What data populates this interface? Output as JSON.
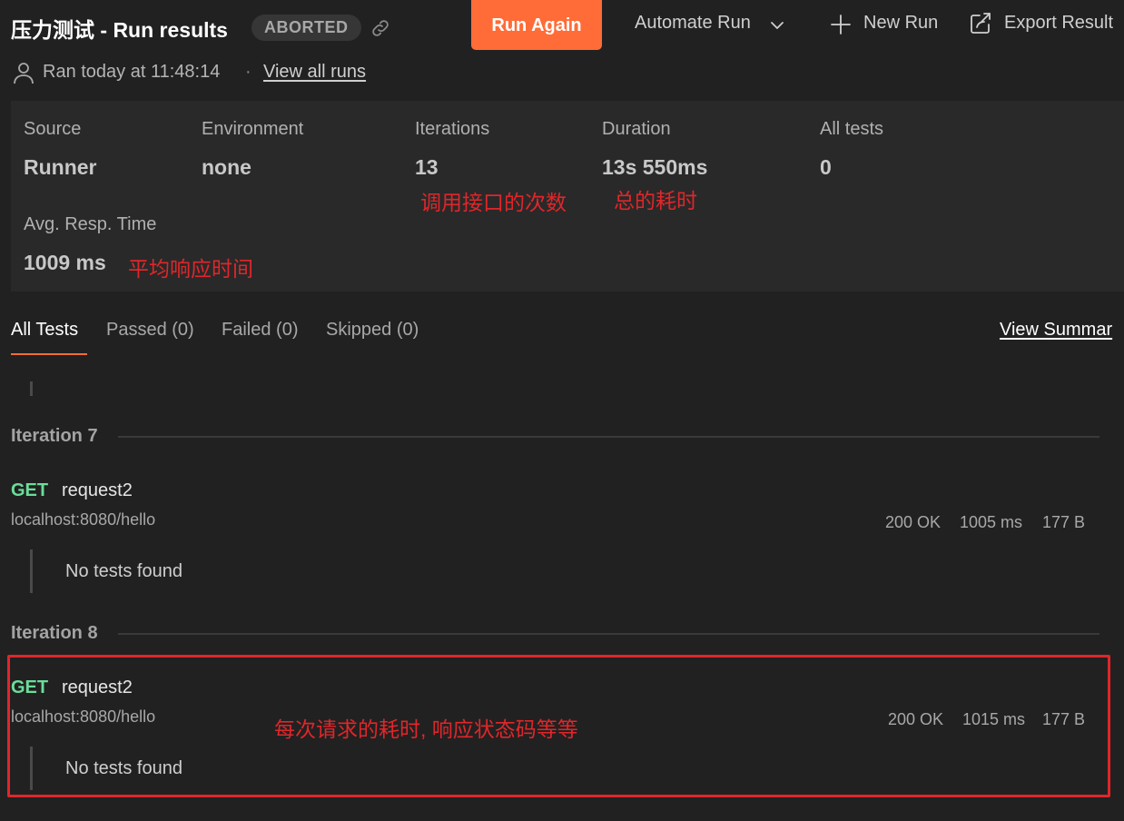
{
  "header": {
    "title": "压力测试 - Run results",
    "status_badge": "ABORTED",
    "run_again": "Run Again",
    "automate_run": "Automate Run",
    "new_run": "New Run",
    "export_results": "Export Result",
    "ran_text": "Ran today at 11:48:14",
    "separator": "·",
    "view_all_runs": "View all runs"
  },
  "summary": {
    "source": {
      "label": "Source",
      "value": "Runner"
    },
    "environment": {
      "label": "Environment",
      "value": "none"
    },
    "iterations": {
      "label": "Iterations",
      "value": "13"
    },
    "duration": {
      "label": "Duration",
      "value": "13s 550ms"
    },
    "all_tests": {
      "label": "All tests",
      "value": "0"
    },
    "avg_resp_time": {
      "label": "Avg. Resp. Time",
      "value": "1009 ms"
    }
  },
  "annotations": {
    "iterations": "调用接口的次数",
    "duration": "总的耗时",
    "avg_resp_time": "平均响应时间",
    "request": "每次请求的耗时, 响应状态码等等"
  },
  "tabs": [
    {
      "label": "All Tests",
      "active": true
    },
    {
      "label": "Passed (0)",
      "active": false
    },
    {
      "label": "Failed (0)",
      "active": false
    },
    {
      "label": "Skipped (0)",
      "active": false
    }
  ],
  "view_summary": "View Summar",
  "iterations": [
    {
      "label": "Iteration 7",
      "request": {
        "method": "GET",
        "name": "request2",
        "url": "localhost:8080/hello",
        "status": "200 OK",
        "time": "1005 ms",
        "size": "177 B"
      },
      "tests_text": "No tests found"
    },
    {
      "label": "Iteration 8",
      "request": {
        "method": "GET",
        "name": "request2",
        "url": "localhost:8080/hello",
        "status": "200 OK",
        "time": "1015 ms",
        "size": "177 B"
      },
      "tests_text": "No tests found"
    }
  ],
  "colors": {
    "accent": "#ff6c37",
    "get_method": "#6bdd9a",
    "annotation": "#e0262a",
    "background": "#212121"
  }
}
